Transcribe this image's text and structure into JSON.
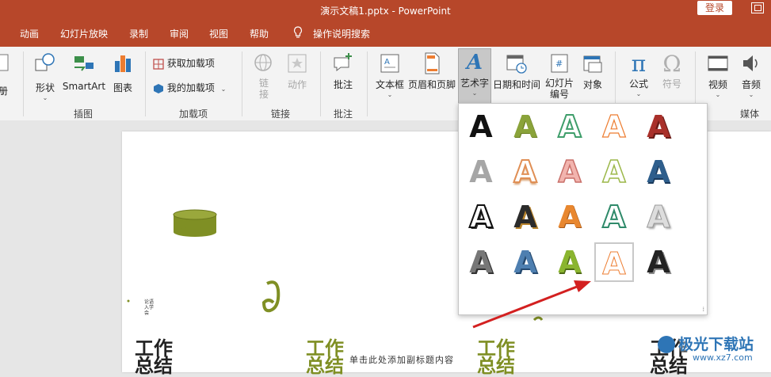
{
  "window": {
    "title": "演示文稿1.pptx  -  PowerPoint",
    "login_label": "登录"
  },
  "tabs": [
    {
      "label": "动画"
    },
    {
      "label": "幻灯片放映"
    },
    {
      "label": "录制"
    },
    {
      "label": "审阅"
    },
    {
      "label": "视图"
    },
    {
      "label": "帮助"
    },
    {
      "label": "操作说明搜索"
    }
  ],
  "ribbon": {
    "partial_left_label": "册",
    "illustrations": {
      "shapes": "形状",
      "smartart": "SmartArt",
      "chart": "图表",
      "group_label": "插图"
    },
    "addins": {
      "get_addins": "获取加载项",
      "my_addins": "我的加载项",
      "group_label": "加载项"
    },
    "links": {
      "link_line1": "链",
      "link_line2": "接",
      "action": "动作",
      "group_label": "链接"
    },
    "comments": {
      "comment": "批注",
      "group_label": "批注"
    },
    "text": {
      "textbox": "文本框",
      "header_footer": "页眉和页脚",
      "wordart": "艺术字",
      "datetime": "日期和时间",
      "slide_number_line1": "幻灯片",
      "slide_number_line2": "编号",
      "object": "对象"
    },
    "symbols": {
      "equation": "公式",
      "symbol": "符号"
    },
    "media": {
      "video": "视频",
      "audio": "音频",
      "group_label": "媒体"
    }
  },
  "wordart_gallery": {
    "glyph": "A",
    "selected_index": 18
  },
  "slide": {
    "title_line1": "工作",
    "title_line2": "总结",
    "subtitle": "单击此处添加副标题内容",
    "tiny_text": "论语\n入学\n会"
  },
  "watermark": {
    "text": "极光下载站",
    "url": "www.xz7.com"
  },
  "colors": {
    "brand": "#b7472a",
    "olive": "#7f8f24",
    "arrow": "#d32020"
  }
}
